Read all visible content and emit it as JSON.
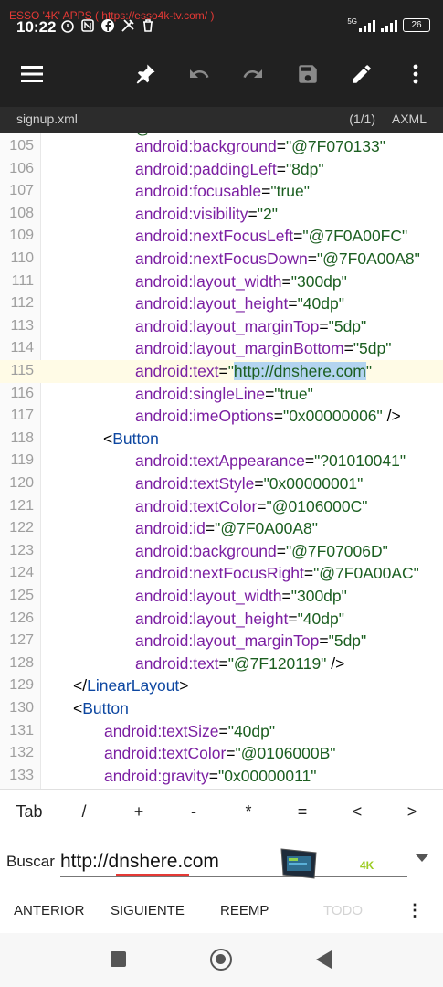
{
  "status": {
    "watermark": "ESSO '4K' APPS (  https://esso4k-tv.com/ )",
    "time": "10:22",
    "network": "5G",
    "battery": "26"
  },
  "toolbar": {
    "icons": [
      "menu-icon",
      "pin-icon",
      "undo-icon",
      "redo-icon",
      "save-icon",
      "edit-icon",
      "more-vert-icon"
    ]
  },
  "file": {
    "name": "signup.xml",
    "page": "(1/1)",
    "mode": "AXML"
  },
  "editor": {
    "partial_line": "@",
    "current_line": 115,
    "lines": [
      {
        "num": "105",
        "indent": 2,
        "attr": "android:background",
        "value": "\"@7F070133\"",
        "tail": ""
      },
      {
        "num": "106",
        "indent": 2,
        "attr": "android:paddingLeft",
        "value": "\"8dp\"",
        "tail": ""
      },
      {
        "num": "107",
        "indent": 2,
        "attr": "android:focusable",
        "value": "\"true\"",
        "tail": ""
      },
      {
        "num": "108",
        "indent": 2,
        "attr": "android:visibility",
        "value": "\"2\"",
        "tail": ""
      },
      {
        "num": "109",
        "indent": 2,
        "attr": "android:nextFocusLeft",
        "value": "\"@7F0A00FC\"",
        "tail": ""
      },
      {
        "num": "110",
        "indent": 2,
        "attr": "android:nextFocusDown",
        "value": "\"@7F0A00A8\"",
        "tail": ""
      },
      {
        "num": "111",
        "indent": 2,
        "attr": "android:layout_width",
        "value": "\"300dp\"",
        "tail": ""
      },
      {
        "num": "112",
        "indent": 2,
        "attr": "android:layout_height",
        "value": "\"40dp\"",
        "tail": ""
      },
      {
        "num": "113",
        "indent": 2,
        "attr": "android:layout_marginTop",
        "value": "\"5dp\"",
        "tail": ""
      },
      {
        "num": "114",
        "indent": 2,
        "attr": "android:layout_marginBottom",
        "value": "\"5dp\"",
        "tail": ""
      },
      {
        "num": "115",
        "indent": 2,
        "attr": "android:text",
        "value": "\"http://dnshere.com\"",
        "tail": "",
        "selected": "http://dnshere.com"
      },
      {
        "num": "116",
        "indent": 2,
        "attr": "android:singleLine",
        "value": "\"true\"",
        "tail": ""
      },
      {
        "num": "117",
        "indent": 2,
        "attr": "android:imeOptions",
        "value": "\"0x00000006\"",
        "tail": " />"
      },
      {
        "num": "118",
        "indent": 1,
        "tag": "<Button",
        "attr": "",
        "value": "",
        "tail": ""
      },
      {
        "num": "119",
        "indent": 2,
        "attr": "android:textAppearance",
        "value": "\"?01010041\"",
        "tail": ""
      },
      {
        "num": "120",
        "indent": 2,
        "attr": "android:textStyle",
        "value": "\"0x00000001\"",
        "tail": ""
      },
      {
        "num": "121",
        "indent": 2,
        "attr": "android:textColor",
        "value": "\"@0106000C\"",
        "tail": ""
      },
      {
        "num": "122",
        "indent": 2,
        "attr": "android:id",
        "value": "\"@7F0A00A8\"",
        "tail": ""
      },
      {
        "num": "123",
        "indent": 2,
        "attr": "android:background",
        "value": "\"@7F07006D\"",
        "tail": ""
      },
      {
        "num": "124",
        "indent": 2,
        "attr": "android:nextFocusRight",
        "value": "\"@7F0A00AC\"",
        "tail": ""
      },
      {
        "num": "125",
        "indent": 2,
        "attr": "android:layout_width",
        "value": "\"300dp\"",
        "tail": ""
      },
      {
        "num": "126",
        "indent": 2,
        "attr": "android:layout_height",
        "value": "\"40dp\"",
        "tail": ""
      },
      {
        "num": "127",
        "indent": 2,
        "attr": "android:layout_marginTop",
        "value": "\"5dp\"",
        "tail": ""
      },
      {
        "num": "128",
        "indent": 2,
        "attr": "android:text",
        "value": "\"@7F120119\"",
        "tail": " />"
      },
      {
        "num": "129",
        "indent": 0,
        "tag": "</LinearLayout>",
        "attr": "",
        "value": "",
        "tail": ""
      },
      {
        "num": "130",
        "indent": 0,
        "tag": "<Button",
        "attr": "",
        "value": "",
        "tail": ""
      },
      {
        "num": "131",
        "indent": 1,
        "attr": "android:textSize",
        "value": "\"40dp\"",
        "tail": ""
      },
      {
        "num": "132",
        "indent": 1,
        "attr": "android:textColor",
        "value": "\"@0106000B\"",
        "tail": ""
      },
      {
        "num": "133",
        "indent": 1,
        "attr": "android:gravity",
        "value": "\"0x00000011\"",
        "tail": ""
      }
    ]
  },
  "keys": [
    "Tab",
    "/",
    "+",
    "-",
    "*",
    "=",
    "<",
    ">"
  ],
  "search": {
    "label": "Buscar",
    "value": "http://dnshere.com",
    "logo_text": "4K"
  },
  "actions": {
    "previous": "ANTERIOR",
    "next": "SIGUIENTE",
    "replace": "REEMP",
    "all": "TODO",
    "more": "⋮"
  },
  "colors": {
    "attr": "#7b1fa2",
    "value": "#1b5e20",
    "tag": "#0d47a1",
    "selection": "#b3d4f0",
    "current_line": "#fffbe6"
  }
}
